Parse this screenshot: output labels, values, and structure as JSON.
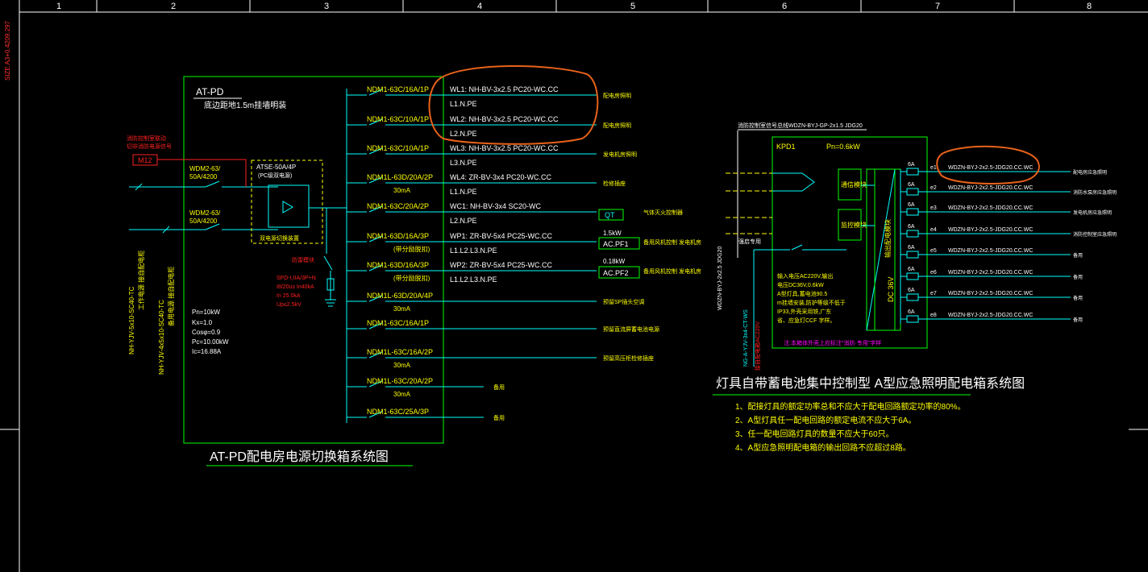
{
  "frame": {
    "col_labels": [
      "1",
      "2",
      "3",
      "4",
      "5",
      "6",
      "7",
      "8"
    ],
    "size_label": "SIZE A3+0.4209.297"
  },
  "left": {
    "box_title": "AT-PD",
    "box_subtitle": "底边距地1.5m挂墙明装",
    "m12": "M12",
    "m12_note1": "消防控制室联动",
    "m12_note2": "切非消防电源信号",
    "sw_in1": [
      "WDM2-63/",
      "50A/4200"
    ],
    "sw_in2": [
      "WDM2-63/",
      "50A/4200"
    ],
    "atse": [
      "ATSE-50A/4P",
      "(PC级双电源)"
    ],
    "atse_note": "双电源切换装置",
    "spd_label": "防雷模块",
    "spd": [
      "SPD-I,IIA/3P+N",
      "I8/20us In40kA",
      "In 25.0kA",
      "Up≤2.5kV"
    ],
    "feeder_v1": "NH-YJV-5x10-SC40-TC",
    "feeder_v1b": "工作电源 接自配电柜",
    "feeder_v2": "NH-YJV-4x5x10-SC40-TC",
    "feeder_v2b": "备用电源 接自配电柜",
    "params": [
      "Pn=10kW",
      "Kx=1.0",
      "Cosφ=0.9",
      "Pc=10.00kW",
      "Ic=16.88A"
    ],
    "breakers": [
      {
        "br": "NDM1-63C/16A/1P",
        "cable": "WL1: NH-BV-3x2.5   PC20-WC.CC",
        "phase": "L1.N.PE",
        "load": "配电房照明",
        "rcd": ""
      },
      {
        "br": "NDM1-63C/10A/1P",
        "cable": "WL2: NH-BV-3x2.5   PC20-WC.CC",
        "phase": "L2.N.PE",
        "load": "配电房照明",
        "rcd": ""
      },
      {
        "br": "NDM1-63C/10A/1P",
        "cable": "WL3: NH-BV-3x2.5   PC20-WC.CC",
        "phase": "L3.N.PE",
        "load": "发电机房照明",
        "rcd": ""
      },
      {
        "br": "NDM1L-63D/20A/2P",
        "cable": "WL4: ZR-BV-3x4    PC20-WC.CC",
        "phase": "L1.N.PE",
        "load": "检修插座",
        "rcd": "30mA"
      },
      {
        "br": "NDM1-63C/20A/2P",
        "cable": "WC1: NH-BV-3x4   SC20-WC",
        "phase": "L2.N.PE",
        "load": "气体灭火控制器",
        "rcd": ""
      },
      {
        "br": "NDM1-63D/16A/3P",
        "cable": "WP1: ZR-BV-5x4   PC25-WC.CC",
        "phase": "L1.L2.L3.N.PE",
        "load": "备用风机控制 发电机房",
        "rcd": "(带分励脱扣)"
      },
      {
        "br": "NDM1-63D/16A/3P",
        "cable": "WP2: ZR-BV-5x4   PC25-WC.CC",
        "phase": "L1.L2.L3.N.PE",
        "load": "备用风机控制 发电机房",
        "rcd": "(带分励脱扣)"
      },
      {
        "br": "NDM1L-63D/20A/4P",
        "cable": "",
        "phase": "",
        "load": "预留SP插头空调",
        "rcd": "30mA"
      },
      {
        "br": "NDM1-63C/16A/1P",
        "cable": "",
        "phase": "",
        "load": "预留直流屏蓄电池电源",
        "rcd": ""
      },
      {
        "br": "NDM1L-63C/16A/2P",
        "cable": "",
        "phase": "",
        "load": "预留高压柜检修插座",
        "rcd": "30mA"
      },
      {
        "br": "NDM1L-63C/20A/2P",
        "cable": "",
        "phase": "",
        "load": "备用",
        "rcd": "30mA"
      },
      {
        "br": "NDM1-63C/25A/3P",
        "cable": "",
        "phase": "",
        "load": "备用",
        "rcd": ""
      }
    ],
    "qt": "QT",
    "pf1_kw": "1.5kW",
    "pf1": "AC.PF1",
    "pf2_kw": "0.18kW",
    "pf2": "AC.PF2",
    "caption": "AT-PD配电房电源切换箱系统图"
  },
  "right": {
    "top_cable": "消防控制室信号总线WDZN-BYJ-GP-2x1.5 JDG20",
    "box_label": "KPD1",
    "pn": "Pn=0.6kW",
    "mod1": "通信模块",
    "mod2": "监控模块",
    "battery": "输出配电模块",
    "dc": "DC 36V",
    "spec": [
      "输入电压AC220V,输出",
      "电压DC36V,0.6kW",
      "A型灯具,蓄电池90.5",
      "m挂墙安装,防护等级不低于",
      "IP33,外壳采用铁,广东",
      "省、应急灯CCF 字样。"
    ],
    "note": "注:本箱体外壳上应标注\"消防·专用\"字样",
    "input_cable": "NG-A-YJV-3x4-CT-WS",
    "input_cable2": "WDZN-BYJ-2x2.5 JDG20",
    "input_sw": "强启专用",
    "input_left": "接自配电箱AC220V",
    "circuits": [
      {
        "n": "e1",
        "cable": "WDZN-BYJ-2x2.5-JDG20.CC.WC",
        "load": "配电房应急照明"
      },
      {
        "n": "e2",
        "cable": "WDZN-BYJ-2x2.5-JDG20.CC.WC",
        "load": "消防水泵房应急照明"
      },
      {
        "n": "e3",
        "cable": "WDZN-BYJ-2x2.5-JDG20.CC.WC",
        "load": "发电机房应急照明"
      },
      {
        "n": "e4",
        "cable": "WDZN-BYJ-2x2.5-JDG20.CC.WC",
        "load": "消防控制室应急照明"
      },
      {
        "n": "e5",
        "cable": "WDZN-BYJ-2x2.5-JDG20.CC.WC",
        "load": "备用"
      },
      {
        "n": "e6",
        "cable": "WDZN-BYJ-2x2.5-JDG20.CC.WC",
        "load": "备用"
      },
      {
        "n": "e7",
        "cable": "WDZN-BYJ-2x2.5-JDG20.CC.WC",
        "load": "备用"
      },
      {
        "n": "e8",
        "cable": "WDZN-BYJ-2x2.5-JDG20.CC.WC",
        "load": "备用"
      }
    ],
    "fuse": "6A",
    "caption": "灯具自带蓄电池集中控制型 A型应急照明配电箱系统图",
    "notes": [
      "1、配接灯具的额定功率总和不应大于配电回路额定功率的80%。",
      "2、A型灯具任一配电回路的额定电流不应大于6A。",
      "3、任一配电回路灯具的数量不应大于60只。",
      "4、A型应急照明配电箱的输出回路不应超过8路。"
    ]
  },
  "colors": {
    "bg": "#000000",
    "frame": "#ffffff",
    "cyan": "#00ffff",
    "yellow": "#ffff00",
    "green": "#00ff00",
    "red": "#ff2020",
    "magenta": "#ff00ff",
    "white": "#ffffff",
    "orange": "#e8621a"
  }
}
